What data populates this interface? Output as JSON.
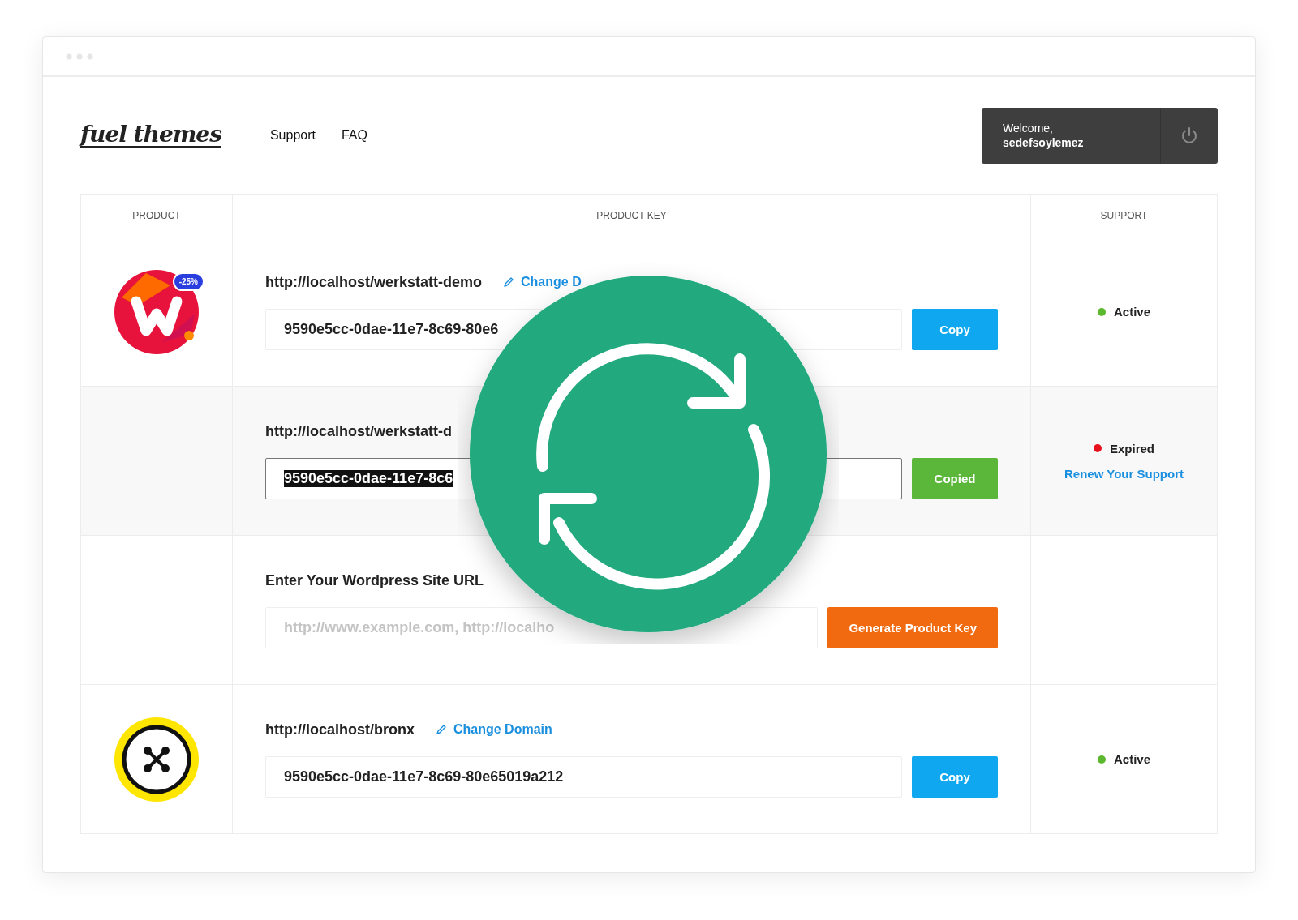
{
  "logo": "fuel themes",
  "nav": [
    "Support",
    "FAQ"
  ],
  "user": {
    "greeting": "Welcome,",
    "name": "sedefsoylemez"
  },
  "table": {
    "columns": [
      "PRODUCT",
      "PRODUCT KEY",
      "SUPPORT"
    ],
    "rows": [
      {
        "kind": "key",
        "logo": {
          "kind": "letter"
        },
        "badge": "-25%",
        "domain": "http://localhost/werkstatt-demo",
        "change": "Change D",
        "key": "9590e5cc-0dae-11e7-8c69-80e6",
        "selected": false,
        "button": {
          "label": "Copy",
          "kind": "copy"
        },
        "status": {
          "label": "Active",
          "color": "#5cb82e"
        }
      },
      {
        "kind": "key",
        "domain": "http://localhost/werkstatt-d",
        "key": "9590e5cc-0dae-11e7-8c6",
        "selected": true,
        "button": {
          "label": "Copied",
          "kind": "copied"
        },
        "status": {
          "label": "Expired",
          "color": "#e8121e"
        },
        "link": "Renew Your Support"
      },
      {
        "kind": "generate",
        "title": "Enter Your Wordpress Site URL",
        "placeholder": "http://www.example.com, http://localho",
        "button": {
          "label": "Generate Product Key",
          "kind": "generate"
        }
      },
      {
        "kind": "key",
        "logo": {
          "kind": "knot"
        },
        "domain": "http://localhost/bronx",
        "change": "Change Domain",
        "key": "9590e5cc-0dae-11e7-8c69-80e65019a212",
        "selected": false,
        "button": {
          "label": "Copy",
          "kind": "copy"
        },
        "status": {
          "label": "Active",
          "color": "#5cb82e"
        }
      }
    ]
  }
}
